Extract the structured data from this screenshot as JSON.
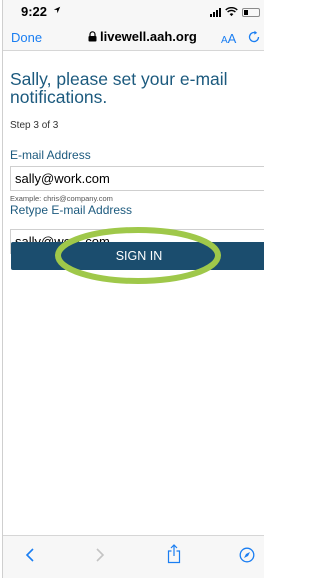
{
  "status_bar": {
    "time": "9:22"
  },
  "browser": {
    "done_label": "Done",
    "url": "livewell.aah.org",
    "text_size_small": "A",
    "text_size_large": "A"
  },
  "form": {
    "heading": "Sally, please set your e-mail notifications.",
    "step": "Step 3 of 3",
    "email_label": "E-mail Address",
    "email_value": "sally@work.com",
    "example": "Example: chris@company.com",
    "retype_label": "Retype E-mail Address",
    "retype_value": "sally@work.com",
    "sign_in_label": "SIGN IN"
  },
  "colors": {
    "accent": "#1a7ef2",
    "heading": "#1c5a7e",
    "button": "#1b4d6e",
    "highlight": "#9fc84a"
  }
}
